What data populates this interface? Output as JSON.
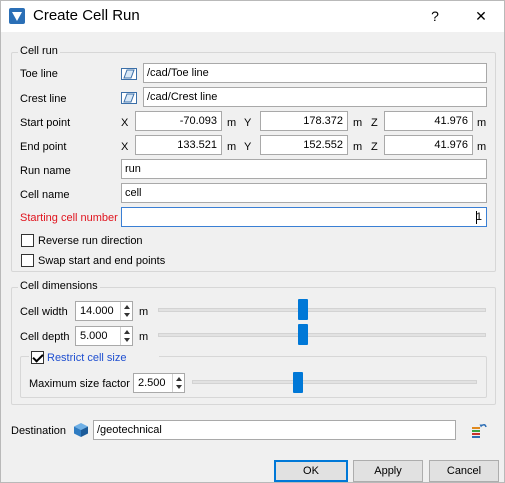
{
  "window": {
    "title": "Create Cell Run",
    "help_label": "?",
    "close_label": "✕"
  },
  "cell_run": {
    "group_label": "Cell run",
    "toe_line": {
      "label": "Toe line",
      "value": "/cad/Toe line"
    },
    "crest_line": {
      "label": "Crest line",
      "value": "/cad/Crest  line"
    },
    "start_point": {
      "label": "Start point",
      "x_label": "X",
      "x": "-70.093",
      "y_label": "Y",
      "y": "178.372",
      "z_label": "Z",
      "z": "41.976",
      "unit": "m"
    },
    "end_point": {
      "label": "End point",
      "x_label": "X",
      "x": "133.521",
      "y_label": "Y",
      "y": "152.552",
      "z_label": "Z",
      "z": "41.976",
      "unit": "m"
    },
    "run_name": {
      "label": "Run name",
      "value": "run"
    },
    "cell_name": {
      "label": "Cell name",
      "value": "cell"
    },
    "starting_cell_number": {
      "label": "Starting cell number",
      "value": "1",
      "label_color": "#e0141e"
    },
    "reverse_run": {
      "label": "Reverse run direction",
      "checked": false
    },
    "swap_points": {
      "label": "Swap start and end points",
      "checked": false
    }
  },
  "cell_dimensions": {
    "group_label": "Cell dimensions",
    "cell_width": {
      "label": "Cell width",
      "value": "14.000",
      "unit": "m",
      "slider_fraction": 0.5
    },
    "cell_depth": {
      "label": "Cell depth",
      "value": "5.000",
      "unit": "m",
      "slider_fraction": 0.5
    },
    "restrict": {
      "label": "Restrict cell size",
      "checked": true
    },
    "max_size_factor": {
      "label": "Maximum size factor",
      "value": "2.500",
      "slider_fraction": 0.37
    }
  },
  "destination": {
    "label": "Destination",
    "value": "/geotechnical"
  },
  "buttons": {
    "ok": "OK",
    "apply": "Apply",
    "cancel": "Cancel"
  },
  "colors": {
    "accent": "#0078d7",
    "required_label": "#e0141e",
    "link_label": "#1f4fd0"
  }
}
